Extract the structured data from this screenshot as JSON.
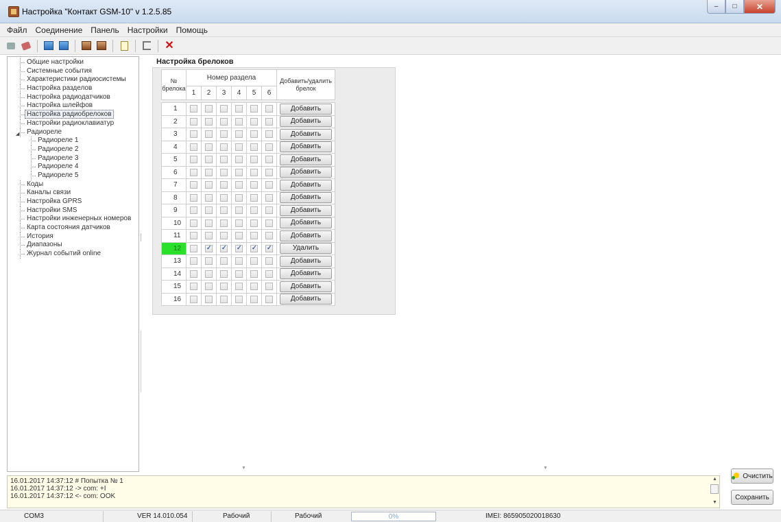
{
  "window": {
    "title": "Настройка \"Контакт GSM-10\" v 1.2.5.85"
  },
  "menu": [
    "Файл",
    "Соединение",
    "Панель",
    "Настройки",
    "Помощь"
  ],
  "toolbar": {
    "icons": [
      "connect-icon",
      "disconnect-icon",
      "read-icon",
      "write-icon",
      "read-file-icon",
      "write-file-icon",
      "notes-icon",
      "exit-icon",
      "close-icon"
    ]
  },
  "tree": {
    "items": [
      {
        "label": "Общие настройки",
        "level": 1
      },
      {
        "label": "Системные события",
        "level": 1
      },
      {
        "label": "Характеристики радиосистемы",
        "level": 1
      },
      {
        "label": "Настройка разделов",
        "level": 1
      },
      {
        "label": "Настройка радиодатчиков",
        "level": 1
      },
      {
        "label": "Настройка шлейфов",
        "level": 1
      },
      {
        "label": "Настройка радиобрелоков",
        "level": 1,
        "selected": true
      },
      {
        "label": "Настройки радиоклавиатур",
        "level": 1
      },
      {
        "label": "Радиореле",
        "level": 1,
        "expanded": true
      },
      {
        "label": "Радиореле 1",
        "level": 2
      },
      {
        "label": "Радиореле 2",
        "level": 2
      },
      {
        "label": "Радиореле 3",
        "level": 2
      },
      {
        "label": "Радиореле 4",
        "level": 2
      },
      {
        "label": "Радиореле 5",
        "level": 2
      },
      {
        "label": "Коды",
        "level": 1
      },
      {
        "label": "Каналы связи",
        "level": 1
      },
      {
        "label": "Настройка GPRS",
        "level": 1
      },
      {
        "label": "Настройки SMS",
        "level": 1
      },
      {
        "label": "Настройки инженерных номеров",
        "level": 1
      },
      {
        "label": "Карта состояния датчиков",
        "level": 1
      },
      {
        "label": "История",
        "level": 1
      },
      {
        "label": "Диапазоны",
        "level": 1
      },
      {
        "label": "Журнал событий online",
        "level": 1
      }
    ]
  },
  "keyfobs": {
    "title": "Настройка брелоков",
    "col_number": "№ брелока",
    "col_partition": "Номер раздела",
    "col_action": "Добавить/удалить брелок",
    "partitions": [
      "1",
      "2",
      "3",
      "4",
      "5",
      "6"
    ],
    "rows": [
      {
        "num": "1",
        "checks": [
          false,
          false,
          false,
          false,
          false,
          false
        ],
        "action": "Добавить",
        "highlight": false
      },
      {
        "num": "2",
        "checks": [
          false,
          false,
          false,
          false,
          false,
          false
        ],
        "action": "Добавить",
        "highlight": false
      },
      {
        "num": "3",
        "checks": [
          false,
          false,
          false,
          false,
          false,
          false
        ],
        "action": "Добавить",
        "highlight": false
      },
      {
        "num": "4",
        "checks": [
          false,
          false,
          false,
          false,
          false,
          false
        ],
        "action": "Добавить",
        "highlight": false
      },
      {
        "num": "5",
        "checks": [
          false,
          false,
          false,
          false,
          false,
          false
        ],
        "action": "Добавить",
        "highlight": false
      },
      {
        "num": "6",
        "checks": [
          false,
          false,
          false,
          false,
          false,
          false
        ],
        "action": "Добавить",
        "highlight": false
      },
      {
        "num": "7",
        "checks": [
          false,
          false,
          false,
          false,
          false,
          false
        ],
        "action": "Добавить",
        "highlight": false
      },
      {
        "num": "8",
        "checks": [
          false,
          false,
          false,
          false,
          false,
          false
        ],
        "action": "Добавить",
        "highlight": false
      },
      {
        "num": "9",
        "checks": [
          false,
          false,
          false,
          false,
          false,
          false
        ],
        "action": "Добавить",
        "highlight": false
      },
      {
        "num": "10",
        "checks": [
          false,
          false,
          false,
          false,
          false,
          false
        ],
        "action": "Добавить",
        "highlight": false
      },
      {
        "num": "11",
        "checks": [
          false,
          false,
          false,
          false,
          false,
          false
        ],
        "action": "Добавить",
        "highlight": false
      },
      {
        "num": "12",
        "checks": [
          false,
          true,
          true,
          true,
          true,
          true
        ],
        "action": "Удалить",
        "highlight": true
      },
      {
        "num": "13",
        "checks": [
          false,
          false,
          false,
          false,
          false,
          false
        ],
        "action": "Добавить",
        "highlight": false
      },
      {
        "num": "14",
        "checks": [
          false,
          false,
          false,
          false,
          false,
          false
        ],
        "action": "Добавить",
        "highlight": false
      },
      {
        "num": "15",
        "checks": [
          false,
          false,
          false,
          false,
          false,
          false
        ],
        "action": "Добавить",
        "highlight": false
      },
      {
        "num": "16",
        "checks": [
          false,
          false,
          false,
          false,
          false,
          false
        ],
        "action": "Добавить",
        "highlight": false
      }
    ]
  },
  "log": {
    "lines": [
      "16.01.2017 14:37:12  # Попытка № 1",
      "16.01.2017 14:37:12 -> com: +I",
      "16.01.2017 14:37:12 <- com:  OOK"
    ]
  },
  "buttons": {
    "clear": "Очистить",
    "save": "Сохранить"
  },
  "status": {
    "port": "COM3",
    "version": "VER 14.010.054",
    "mode1": "Рабочий",
    "mode2": "Рабочий",
    "progress_text": "0%",
    "progress_value": 0,
    "imei": "IMEI: 865905020018630"
  },
  "colors": {
    "highlight_green": "#29e02b"
  }
}
